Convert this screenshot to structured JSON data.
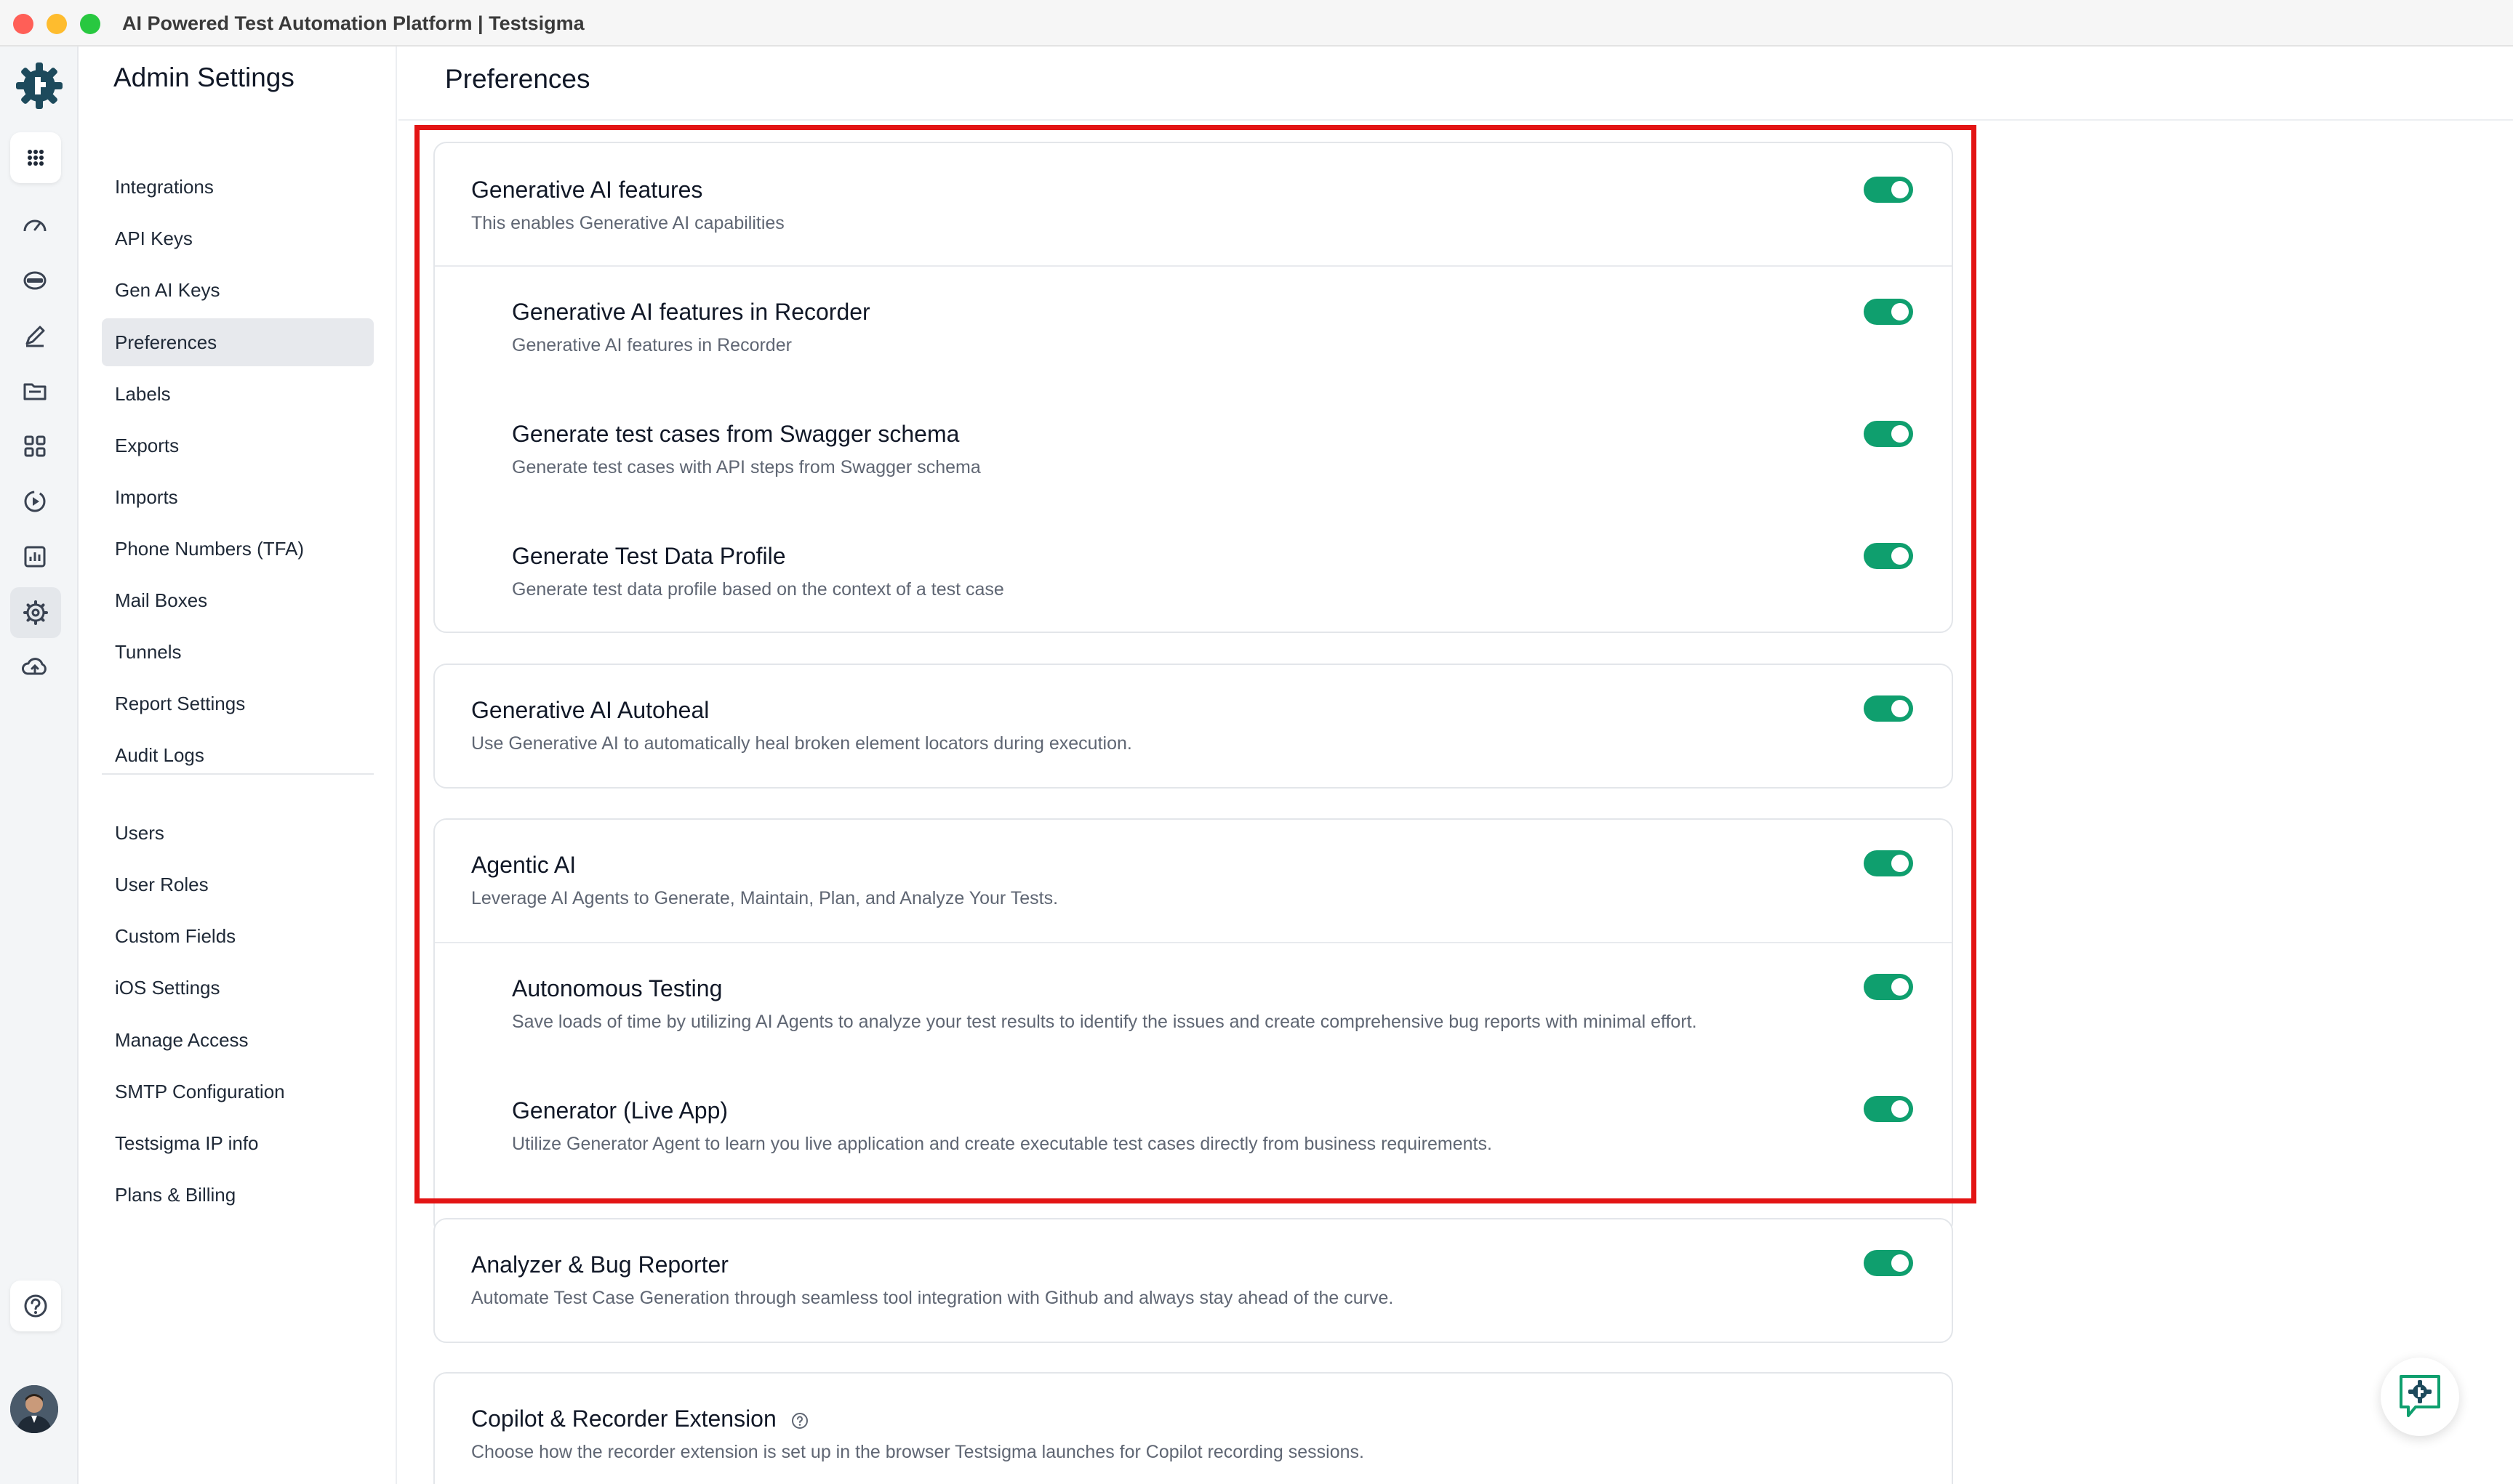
{
  "window": {
    "title": "AI Powered Test Automation Platform | Testsigma"
  },
  "rail": {
    "icons": [
      "testsigma-logo-icon",
      "apps-grid-icon",
      "dashboard-icon",
      "test-cases-icon",
      "edit-icon",
      "folder-icon",
      "modules-icon",
      "run-icon",
      "reports-icon",
      "settings-icon",
      "cloud-upload-icon",
      "help-icon",
      "avatar"
    ]
  },
  "sidebar": {
    "title": "Admin Settings",
    "items": [
      {
        "label": "Integrations"
      },
      {
        "label": "API Keys"
      },
      {
        "label": "Gen AI Keys"
      },
      {
        "label": "Preferences",
        "active": true
      },
      {
        "label": "Labels"
      },
      {
        "label": "Exports"
      },
      {
        "label": "Imports"
      },
      {
        "label": "Phone Numbers (TFA)"
      },
      {
        "label": "Mail Boxes"
      },
      {
        "label": "Tunnels"
      },
      {
        "label": "Report Settings"
      },
      {
        "label": "Audit Logs"
      }
    ],
    "items2": [
      {
        "label": "Users"
      },
      {
        "label": "User Roles"
      },
      {
        "label": "Custom Fields"
      },
      {
        "label": "iOS Settings"
      },
      {
        "label": "Manage Access"
      },
      {
        "label": "SMTP Configuration"
      },
      {
        "label": "Testsigma IP info"
      },
      {
        "label": "Plans & Billing"
      }
    ]
  },
  "main": {
    "title": "Preferences",
    "cards": [
      {
        "sections": [
          {
            "title": "Generative AI features",
            "desc": "This enables Generative AI capabilities",
            "enabled": true
          },
          {
            "title": "Generative AI features in Recorder",
            "desc": "Generative AI features in Recorder",
            "enabled": true
          },
          {
            "title": "Generate test cases from Swagger schema",
            "desc": "Generate test cases with API steps from Swagger schema",
            "enabled": true
          },
          {
            "title": "Generate Test Data Profile",
            "desc": "Generate test data profile based on the context of a test case",
            "enabled": true
          }
        ]
      },
      {
        "sections": [
          {
            "title": "Generative AI Autoheal",
            "desc": "Use Generative AI to automatically heal broken element locators during execution.",
            "enabled": true
          }
        ]
      },
      {
        "sections": [
          {
            "title": "Agentic AI",
            "desc": "Leverage AI Agents to Generate, Maintain, Plan, and Analyze Your Tests.",
            "enabled": true
          },
          {
            "title": "Autonomous Testing",
            "desc": "Save loads of time by utilizing AI Agents to analyze your test results to identify the issues and create comprehensive bug reports with minimal effort.",
            "enabled": true
          },
          {
            "title": "Generator (Live App)",
            "desc": "Utilize Generator Agent to learn you live application and create executable test cases directly from business requirements.",
            "enabled": true
          }
        ]
      },
      {
        "sections": [
          {
            "title": "Analyzer & Bug Reporter",
            "desc": "Automate Test Case Generation through seamless tool integration with Github and always stay ahead of the curve.",
            "enabled": true
          }
        ]
      },
      {
        "sections": [
          {
            "title": "Copilot & Recorder Extension",
            "desc": "Choose how the recorder extension is set up in the browser Testsigma launches for Copilot recording sessions."
          }
        ]
      }
    ]
  },
  "colors": {
    "toggle_on": "#0f9f6e",
    "highlight": "#e31414",
    "brand": "#1d4a5c"
  }
}
